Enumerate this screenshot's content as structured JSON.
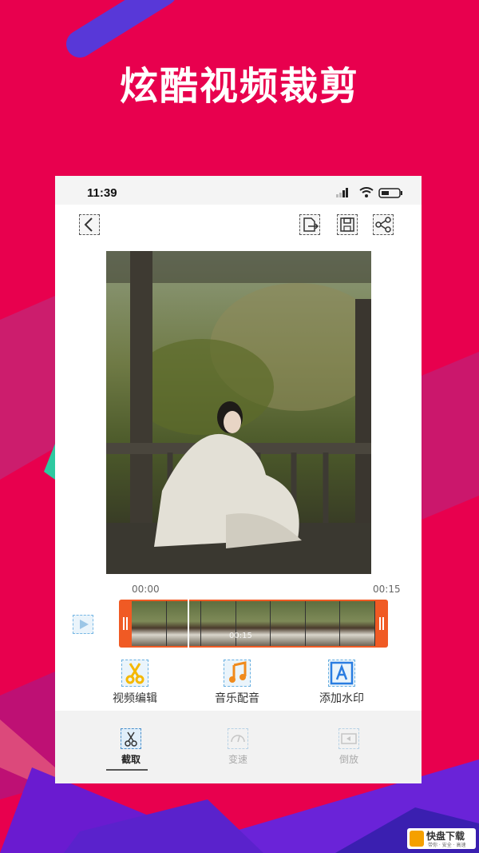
{
  "banner": {
    "title": "炫酷视频裁剪"
  },
  "status_bar": {
    "time": "11:39"
  },
  "toolbar": {
    "back_icon": "chevron-left-icon",
    "export_icon": "export-icon",
    "save_icon": "save-icon",
    "share_icon": "share-icon"
  },
  "video": {
    "start_time": "00:00",
    "end_time": "00:15",
    "strip_time": "00:15"
  },
  "tools": [
    {
      "label": "视频编辑",
      "icon": "scissors-icon",
      "color": "#f5b800"
    },
    {
      "label": "音乐配音",
      "icon": "music-note-icon",
      "color": "#f08a1c"
    },
    {
      "label": "添加水印",
      "icon": "text-a-icon",
      "color": "#2a7de1"
    }
  ],
  "tabs": [
    {
      "label": "截取",
      "icon": "scissors-icon",
      "active": true
    },
    {
      "label": "变速",
      "icon": "speed-gauge-icon",
      "active": false
    },
    {
      "label": "倒放",
      "icon": "reverse-play-icon",
      "active": false
    }
  ],
  "watermark": {
    "text": "快盘下载",
    "sub": "带你 · 安全 · 高速"
  },
  "colors": {
    "background": "#e8004e",
    "accent_orange": "#f05a24",
    "purple": "#5a2fd6"
  }
}
